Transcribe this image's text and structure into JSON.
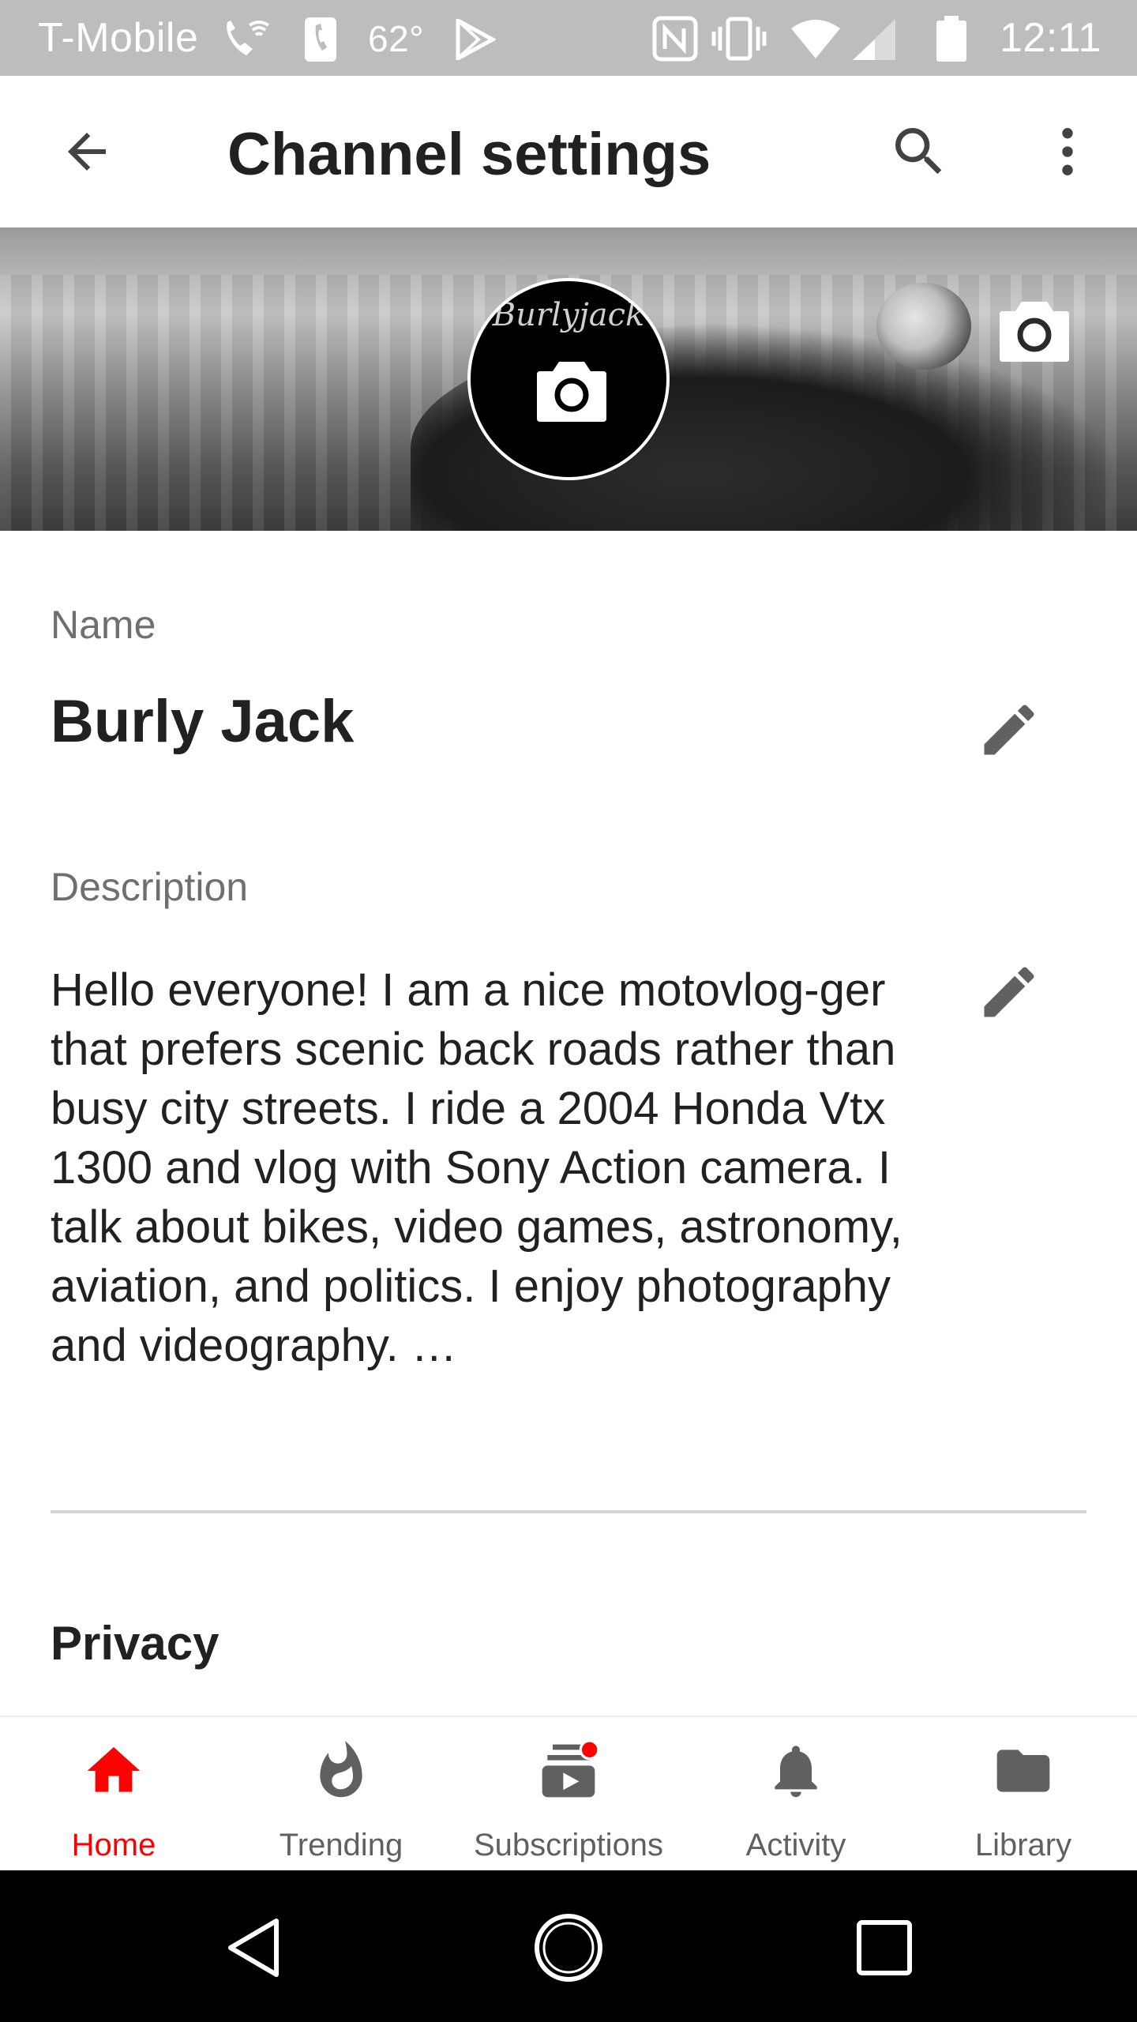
{
  "status_bar": {
    "carrier": "T-Mobile",
    "temperature": "62°",
    "time": "12:11"
  },
  "app_bar": {
    "title": "Channel settings",
    "back_icon": "arrow-back-icon",
    "search_icon": "search-icon",
    "more_icon": "more-vert-icon"
  },
  "banner": {
    "avatar_text": "Burlyjack",
    "avatar_camera_icon": "camera-icon",
    "banner_camera_icon": "camera-icon"
  },
  "channel": {
    "name_label": "Name",
    "name_value": "Burly Jack",
    "description_label": "Description",
    "description_value": "Hello everyone! I am a nice motovlog-ger that prefers scenic back roads rather than busy city streets. I ride a 2004 Honda Vtx 1300 and vlog with Sony Action camera. I talk about bikes, video games, astronomy, aviation, and politics. I enjoy photography and videography. …",
    "edit_icon": "edit-icon",
    "privacy_title": "Privacy"
  },
  "bottom_nav": {
    "items": [
      {
        "label": "Home",
        "icon": "home-icon",
        "active": true
      },
      {
        "label": "Trending",
        "icon": "flame-icon",
        "active": false
      },
      {
        "label": "Subscriptions",
        "icon": "subscriptions-icon",
        "active": false
      },
      {
        "label": "Activity",
        "icon": "bell-icon",
        "active": false
      },
      {
        "label": "Library",
        "icon": "folder-icon",
        "active": false
      }
    ]
  },
  "colors": {
    "accent": "#ff0000",
    "text_primary": "#212121",
    "text_secondary": "#6f6f6f",
    "status_bar": "#bdbdbd"
  }
}
